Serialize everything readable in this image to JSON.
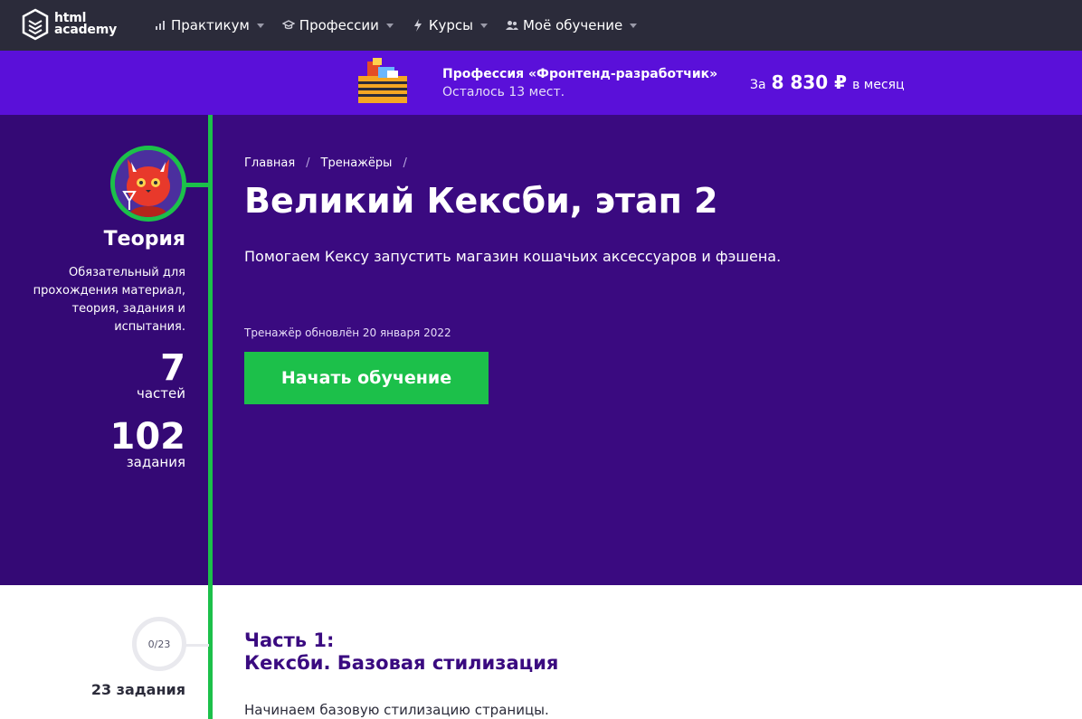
{
  "nav": {
    "logo_line1": "html",
    "logo_line2": "academy",
    "items": [
      {
        "label": "Практикум",
        "icon": "bars-icon"
      },
      {
        "label": "Профессии",
        "icon": "graduation-cap-icon"
      },
      {
        "label": "Курсы",
        "icon": "lightning-icon"
      },
      {
        "label": "Моё обучение",
        "icon": "users-icon"
      }
    ]
  },
  "promo": {
    "title": "Профессия «Фронтенд-разработчик»",
    "subtitle": "Осталось 13 мест.",
    "price_prefix": "За",
    "price_amount": "8 830 ₽",
    "price_suffix": "в месяц"
  },
  "sidebar": {
    "title": "Теория",
    "description": "Обязательный для прохождения материал, теория, задания и испытания.",
    "parts_count": "7",
    "parts_label": "частей",
    "tasks_count": "102",
    "tasks_label": "задания"
  },
  "hero": {
    "breadcrumb": [
      "Главная",
      "Тренажёры"
    ],
    "title": "Великий Кексби, этап 2",
    "description": "Помогаем Кексу запустить магазин кошачьих аксессуаров и фэшена.",
    "updated": "Тренажёр обновлён 20 января 2022",
    "start_button": "Начать обучение"
  },
  "part1": {
    "progress": "0/23",
    "tasks": "23 задания",
    "title_line1": "Часть 1:",
    "title_line2": "Кексби. Базовая стилизация",
    "description": "Начинаем базовую стилизацию страницы."
  },
  "colors": {
    "nav_bg": "#2b2b3a",
    "promo_bg": "#5a10d9",
    "hero_bg": "#3a0a80",
    "accent_green": "#1cc04a"
  }
}
